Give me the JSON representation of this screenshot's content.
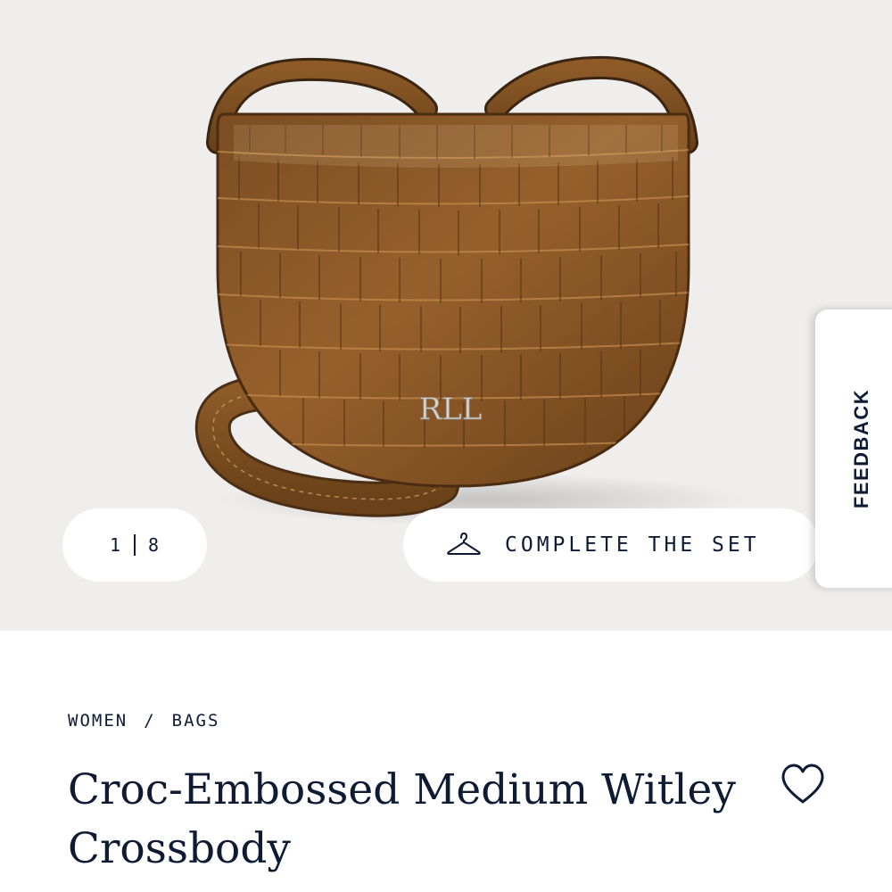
{
  "gallery": {
    "current": "1",
    "total": "8",
    "logo_monogram": "RLL"
  },
  "complete_the_set": {
    "label": "COMPLETE THE SET",
    "icon": "hanger-icon"
  },
  "feedback": {
    "label": "FEEDBACK"
  },
  "breadcrumb": {
    "items": [
      "WOMEN",
      "BAGS"
    ],
    "separator": "/"
  },
  "product": {
    "title": "Croc-Embossed Medium Witley Crossbody",
    "wishlist_icon": "heart-icon"
  },
  "colors": {
    "navy": "#0d1b33",
    "hero_bg": "#efeeed",
    "bag_brown": "#8a5a2b"
  }
}
